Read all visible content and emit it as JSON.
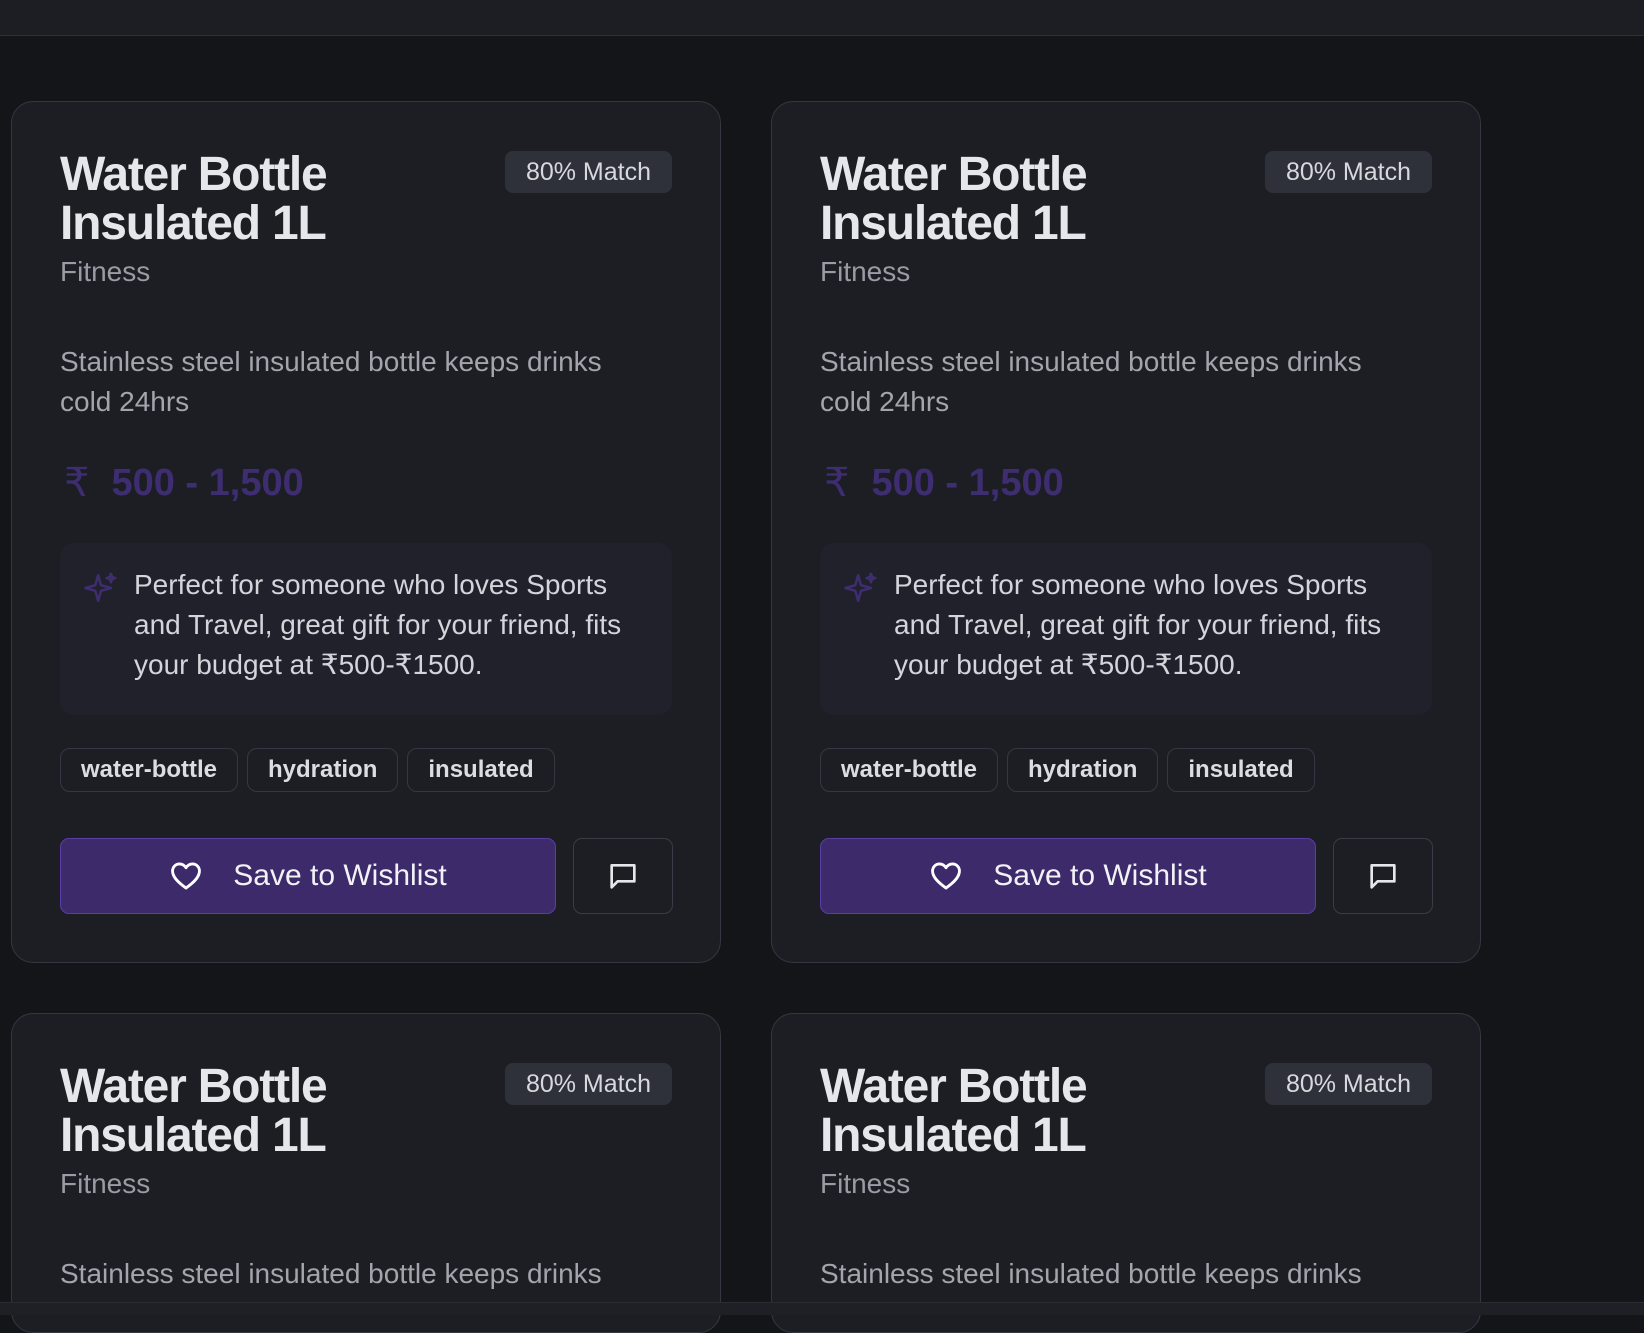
{
  "products": [
    {
      "title": "Water Bottle Insulated 1L",
      "badge": "80% Match",
      "category": "Fitness",
      "description": "Stainless steel insulated bottle keeps drinks cold 24hrs",
      "currency_symbol": "₹",
      "price_range": "500 - 1,500",
      "reason": "Perfect for someone who loves Sports and Travel, great gift for your friend, fits your budget at ₹500-₹1500.",
      "tags": [
        "water-bottle",
        "hydration",
        "insulated"
      ],
      "wishlist_label": "Save to Wishlist"
    },
    {
      "title": "Water Bottle Insulated 1L",
      "badge": "80% Match",
      "category": "Fitness",
      "description": "Stainless steel insulated bottle keeps drinks cold 24hrs",
      "currency_symbol": "₹",
      "price_range": "500 - 1,500",
      "reason": "Perfect for someone who loves Sports and Travel, great gift for your friend, fits your budget at ₹500-₹1500.",
      "tags": [
        "water-bottle",
        "hydration",
        "insulated"
      ],
      "wishlist_label": "Save to Wishlist"
    },
    {
      "title": "Water Bottle Insulated 1L",
      "badge": "80% Match",
      "category": "Fitness",
      "description": "Stainless steel insulated bottle keeps drinks"
    },
    {
      "title": "Water Bottle Insulated 1L",
      "badge": "80% Match",
      "category": "Fitness",
      "description": "Stainless steel insulated bottle keeps drinks"
    }
  ],
  "icons": {
    "wishlist": "heart-icon",
    "comment": "message-square-icon",
    "reason": "sparkles-icon"
  },
  "colors": {
    "background": "#141519",
    "card": "#1c1e24",
    "accent": "#3c2a6b",
    "price": "#3f2d72"
  }
}
